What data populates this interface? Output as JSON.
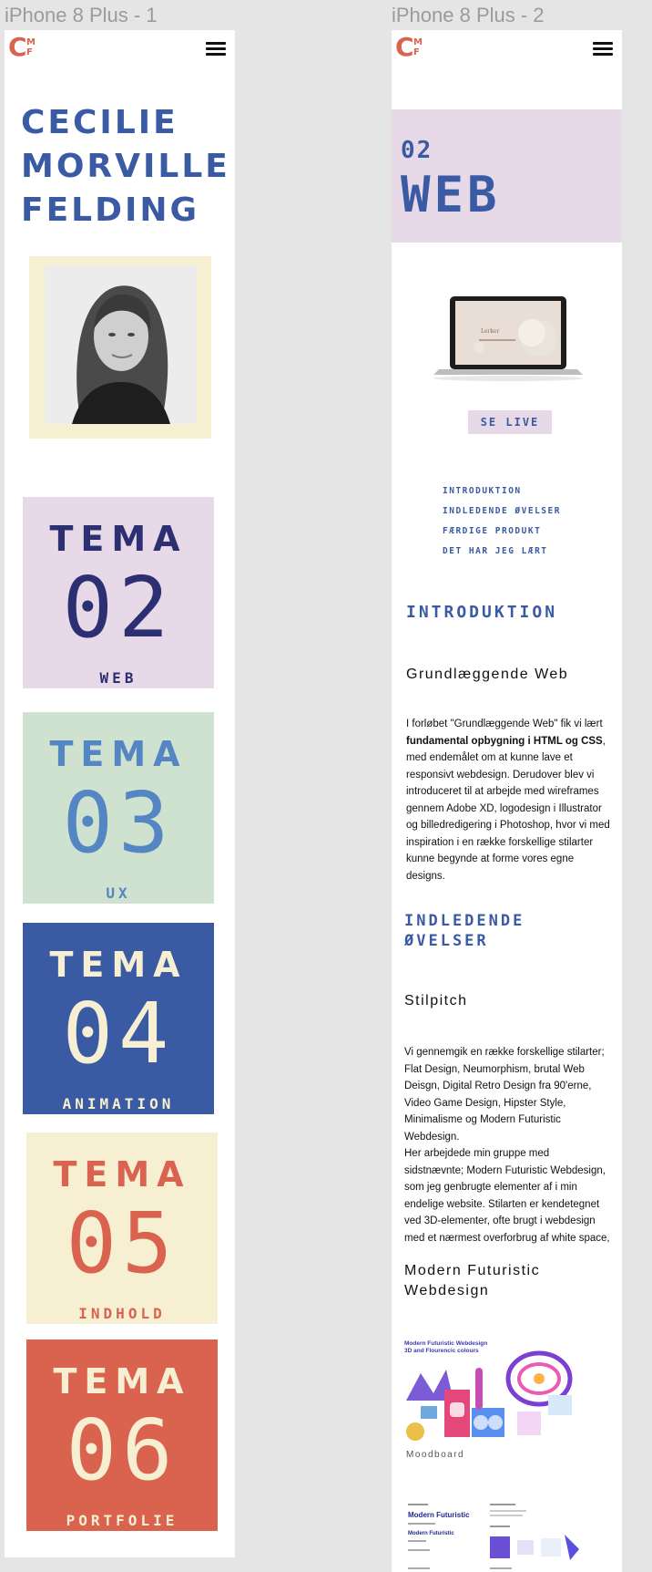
{
  "frames": {
    "frame1_label": "iPhone 8 Plus - 1",
    "frame2_label": "iPhone 8 Plus - 2"
  },
  "logo": {
    "big": "C",
    "top": "M",
    "bottom": "F"
  },
  "icons": {
    "menu": "hamburger-menu-icon"
  },
  "colors": {
    "blue": "#3a5ba4",
    "navy": "#2d2f73",
    "lilac": "#e8d9e9",
    "mint": "#cfe2d0",
    "sky": "#5486c4",
    "cream": "#f6efd2",
    "coral": "#d9634f"
  },
  "frame1": {
    "name_lines": [
      "CECILIE",
      "MORVILLE",
      "FELDING"
    ],
    "temas": [
      {
        "word": "TEMA",
        "number": "02",
        "label": "WEB"
      },
      {
        "word": "TEMA",
        "number": "03",
        "label": "UX"
      },
      {
        "word": "TEMA",
        "number": "04",
        "label": "ANIMATION"
      },
      {
        "word": "TEMA",
        "number": "05",
        "label": "INDHOLD"
      },
      {
        "word": "TEMA",
        "number": "06",
        "label": "PORTFOLIE"
      }
    ]
  },
  "frame2": {
    "hero_number": "02",
    "hero_title": "WEB",
    "se_live": "SE LIVE",
    "toc": [
      "INTRODUKTION",
      "INDLEDENDE ØVELSER",
      "FÆRDIGE PRODUKT",
      "DET HAR JEG LÆRT"
    ],
    "intro_heading": "INTRODUKTION",
    "intro_sub": "Grundlæggende Web",
    "intro_text_a": "I forløbet \"Grundlæggende Web\" fik vi lært ",
    "intro_text_bold": "fundamental opbygning i HTML og CSS",
    "intro_text_b": ", med endemålet om at kunne lave et responsivt webdesign. Derudover blev vi introduceret til at arbejde med wireframes gennem Adobe XD, logodesign i Illustrator og billedredigering i Photoshop, hvor vi med inspiration i en række forskellige stilarter kunne begynde at forme vores egne designs.",
    "ovelser_heading_1": "INDLEDENDE",
    "ovelser_heading_2": "ØVELSER",
    "stilpitch_sub": "Stilpitch",
    "stilpitch_text": "Vi gennemgik en række forskellige stilarter; Flat Design, Neumorphism, brutal Web Deisgn, Digital Retro Design fra 90'erne, Video Game Design, Hipster Style, Minimalisme og Modern Futuristic Webdesign.",
    "stilpitch_text_2": "Her arbejdede min gruppe med sidstnævnte; Modern Futuristic Webdesign, som jeg genbrugte elementer af i min endelige website. Stilarten er kendetegnet ved 3D-elementer, ofte brugt i webdesign med et nærmest overforbrug af white space,",
    "mf_sub_1": "Modern Futuristic",
    "mf_sub_2": "Webdesign",
    "moodboard_title_1": "Modern Futuristic Webdesign",
    "moodboard_title_2": "3D and Flourencic colours",
    "moodboard_caption": "Moodboard",
    "laptop_screen_text": "Lerker",
    "stylesheet_heading": "Modern Futuristic",
    "stylesheet_heading_2": "Modern Futuristic"
  }
}
